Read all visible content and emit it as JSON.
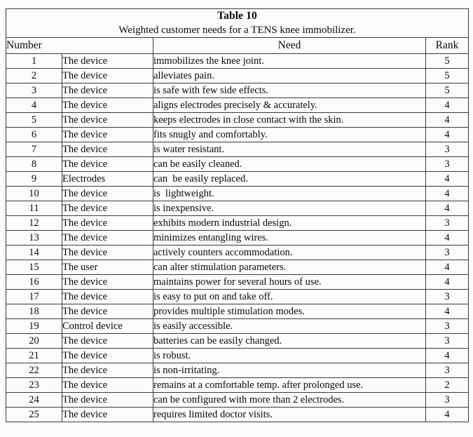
{
  "table": {
    "title": "Table 10",
    "caption": "Weighted customer needs for a TENS knee immobilizer.",
    "columns": {
      "number": "Number",
      "need": "Need",
      "rank": "Rank"
    },
    "rows": [
      {
        "number": "1",
        "subject": "The device",
        "need": "immobilizes the knee joint.",
        "rank": "5"
      },
      {
        "number": "2",
        "subject": "The device",
        "need": "alleviates pain.",
        "rank": "5"
      },
      {
        "number": "3",
        "subject": "The device",
        "need": "is safe with few side effects.",
        "rank": "5"
      },
      {
        "number": "4",
        "subject": "The device",
        "need": "aligns electrodes precisely & accurately.",
        "rank": "4"
      },
      {
        "number": "5",
        "subject": "The device",
        "need": "keeps electrodes in close contact with the skin.",
        "rank": "4"
      },
      {
        "number": "6",
        "subject": "The device",
        "need": "fits snugly and comfortably.",
        "rank": "4"
      },
      {
        "number": "7",
        "subject": "The device",
        "need": "is water resistant.",
        "rank": "3"
      },
      {
        "number": "8",
        "subject": "The device",
        "need": "can be easily cleaned.",
        "rank": "3"
      },
      {
        "number": "9",
        "subject": "Electrodes",
        "need": "can  be easily replaced.",
        "rank": "4"
      },
      {
        "number": "10",
        "subject": "The device",
        "need": "is  lightweight.",
        "rank": "4"
      },
      {
        "number": "11",
        "subject": "The device",
        "need": "is inexpensive.",
        "rank": "4"
      },
      {
        "number": "12",
        "subject": "The device",
        "need": "exhibits modern industrial design.",
        "rank": "3"
      },
      {
        "number": "13",
        "subject": "The device",
        "need": "minimizes entangling wires.",
        "rank": "4"
      },
      {
        "number": "14",
        "subject": "The device",
        "need": "actively counters accommodation.",
        "rank": "3"
      },
      {
        "number": "15",
        "subject": "The user",
        "need": "can alter stimulation parameters.",
        "rank": "4"
      },
      {
        "number": "16",
        "subject": "The device",
        "need": "maintains power for several hours of use.",
        "rank": "4"
      },
      {
        "number": "17",
        "subject": "The device",
        "need": "is easy to put on and take off.",
        "rank": "3"
      },
      {
        "number": "18",
        "subject": "The device",
        "need": "provides multiple stimulation modes.",
        "rank": "4"
      },
      {
        "number": "19",
        "subject": "Control device",
        "need": "is easily accessible.",
        "rank": "3"
      },
      {
        "number": "20",
        "subject": "The device",
        "need": "batteries can be easily changed.",
        "rank": "3"
      },
      {
        "number": "21",
        "subject": "The device",
        "need": "is robust.",
        "rank": "4"
      },
      {
        "number": "22",
        "subject": "The device",
        "need": "is non-irritating.",
        "rank": "3"
      },
      {
        "number": "23",
        "subject": "The device",
        "need": "remains at a comfortable temp. after prolonged use.",
        "rank": "2"
      },
      {
        "number": "24",
        "subject": "The device",
        "need": "can be configured with more than 2 electrodes.",
        "rank": "3"
      },
      {
        "number": "25",
        "subject": "The device",
        "need": "requires limited doctor visits.",
        "rank": "4"
      }
    ]
  },
  "colors": {
    "page_background": "#fdfdfc",
    "table_background": "#fcfcfb",
    "rule": "#3b3b3b",
    "text": "#0a0a0a"
  }
}
